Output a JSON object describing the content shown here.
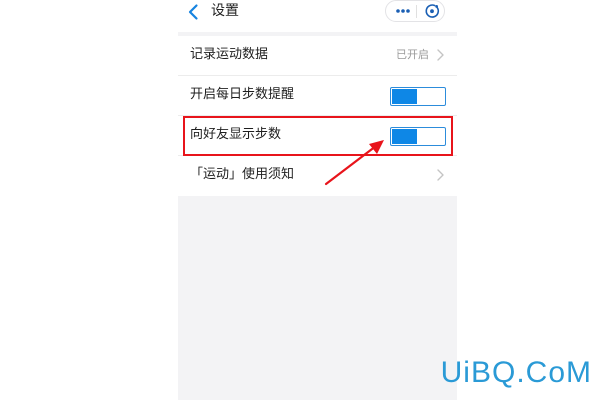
{
  "navbar": {
    "title": "设置",
    "back_icon": "chevron-left-icon",
    "more_icon": "more-dots-icon",
    "close_icon": "close-circle-icon"
  },
  "settings": {
    "items": [
      {
        "label": "记录运动数据",
        "value": "已开启",
        "control": "chevron"
      },
      {
        "label": "开启每日步数提醒",
        "control": "toggle",
        "on": true
      },
      {
        "label": "向好友显示步数",
        "control": "toggle",
        "on": true,
        "highlighted": true
      },
      {
        "label": "「运动」使用须知",
        "control": "chevron"
      }
    ]
  },
  "annotation": {
    "highlight_color": "#e8141b",
    "arrow_color": "#e8141b"
  },
  "colors": {
    "accent": "#0e87e6",
    "background": "#f3f3f5"
  },
  "watermark": {
    "text": "UiBQ.CoM"
  }
}
